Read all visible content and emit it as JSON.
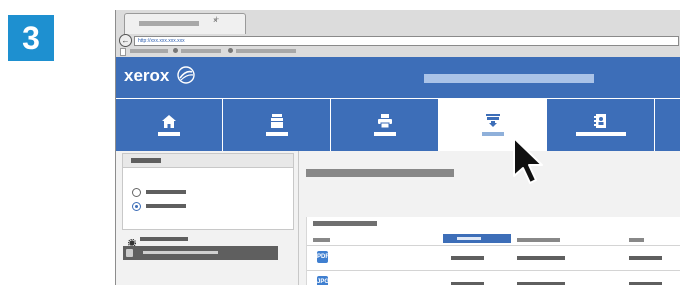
{
  "step_number": "3",
  "browser": {
    "tab_close": "×",
    "tab_new": "+",
    "back_glyph": "←",
    "address": "http://xxx.xxx.xxx.xxx"
  },
  "app": {
    "logo_text": "xerox",
    "accent": "#3d6eb8",
    "nav_items": [
      "home-icon",
      "jobs-icon",
      "print-icon",
      "scan-icon",
      "address-book-icon"
    ],
    "active_nav": "scan-icon",
    "sidebar": {
      "radio_selected_index": 1
    },
    "table": {
      "file_icons": [
        "PDF",
        "JPG"
      ]
    }
  }
}
